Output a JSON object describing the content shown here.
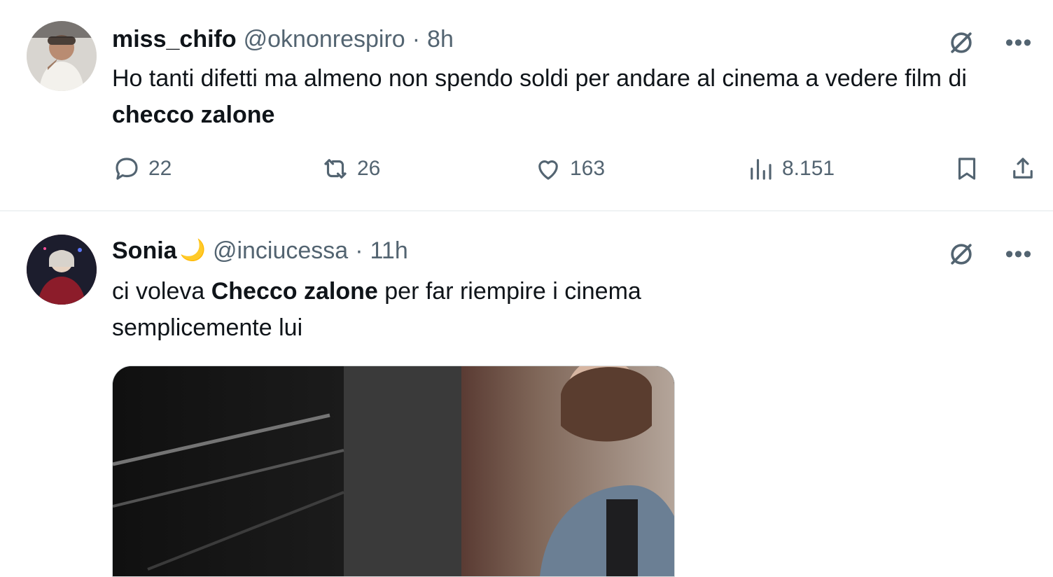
{
  "tweets": [
    {
      "author_name": "miss_chifo",
      "handle": "@oknonrespiro",
      "separator": "·",
      "time": "8h",
      "text_parts": [
        "Ho tanti difetti ma almeno non spendo soldi per andare al cinema a vedere film di ",
        "checco zalone"
      ],
      "stats": {
        "replies": "22",
        "retweets": "26",
        "likes": "163",
        "views": "8.151"
      }
    },
    {
      "author_name": "Sonia",
      "emoji": "🌙",
      "handle": "@inciucessa",
      "separator": "·",
      "time": "11h",
      "text_parts": [
        "ci voleva ",
        "Checco zalone",
        " per far riempire i cinema",
        "semplicemente lui"
      ]
    }
  ],
  "icons": {
    "grok": "slashed-circle-icon",
    "more": "more-dots-icon",
    "reply": "reply-icon",
    "retweet": "retweet-icon",
    "like": "heart-icon",
    "views": "views-bars-icon",
    "bookmark": "bookmark-icon",
    "share": "share-icon"
  },
  "colors": {
    "text_primary": "#0f1419",
    "text_secondary": "#536471",
    "divider": "#eff3f4",
    "background": "#ffffff"
  }
}
